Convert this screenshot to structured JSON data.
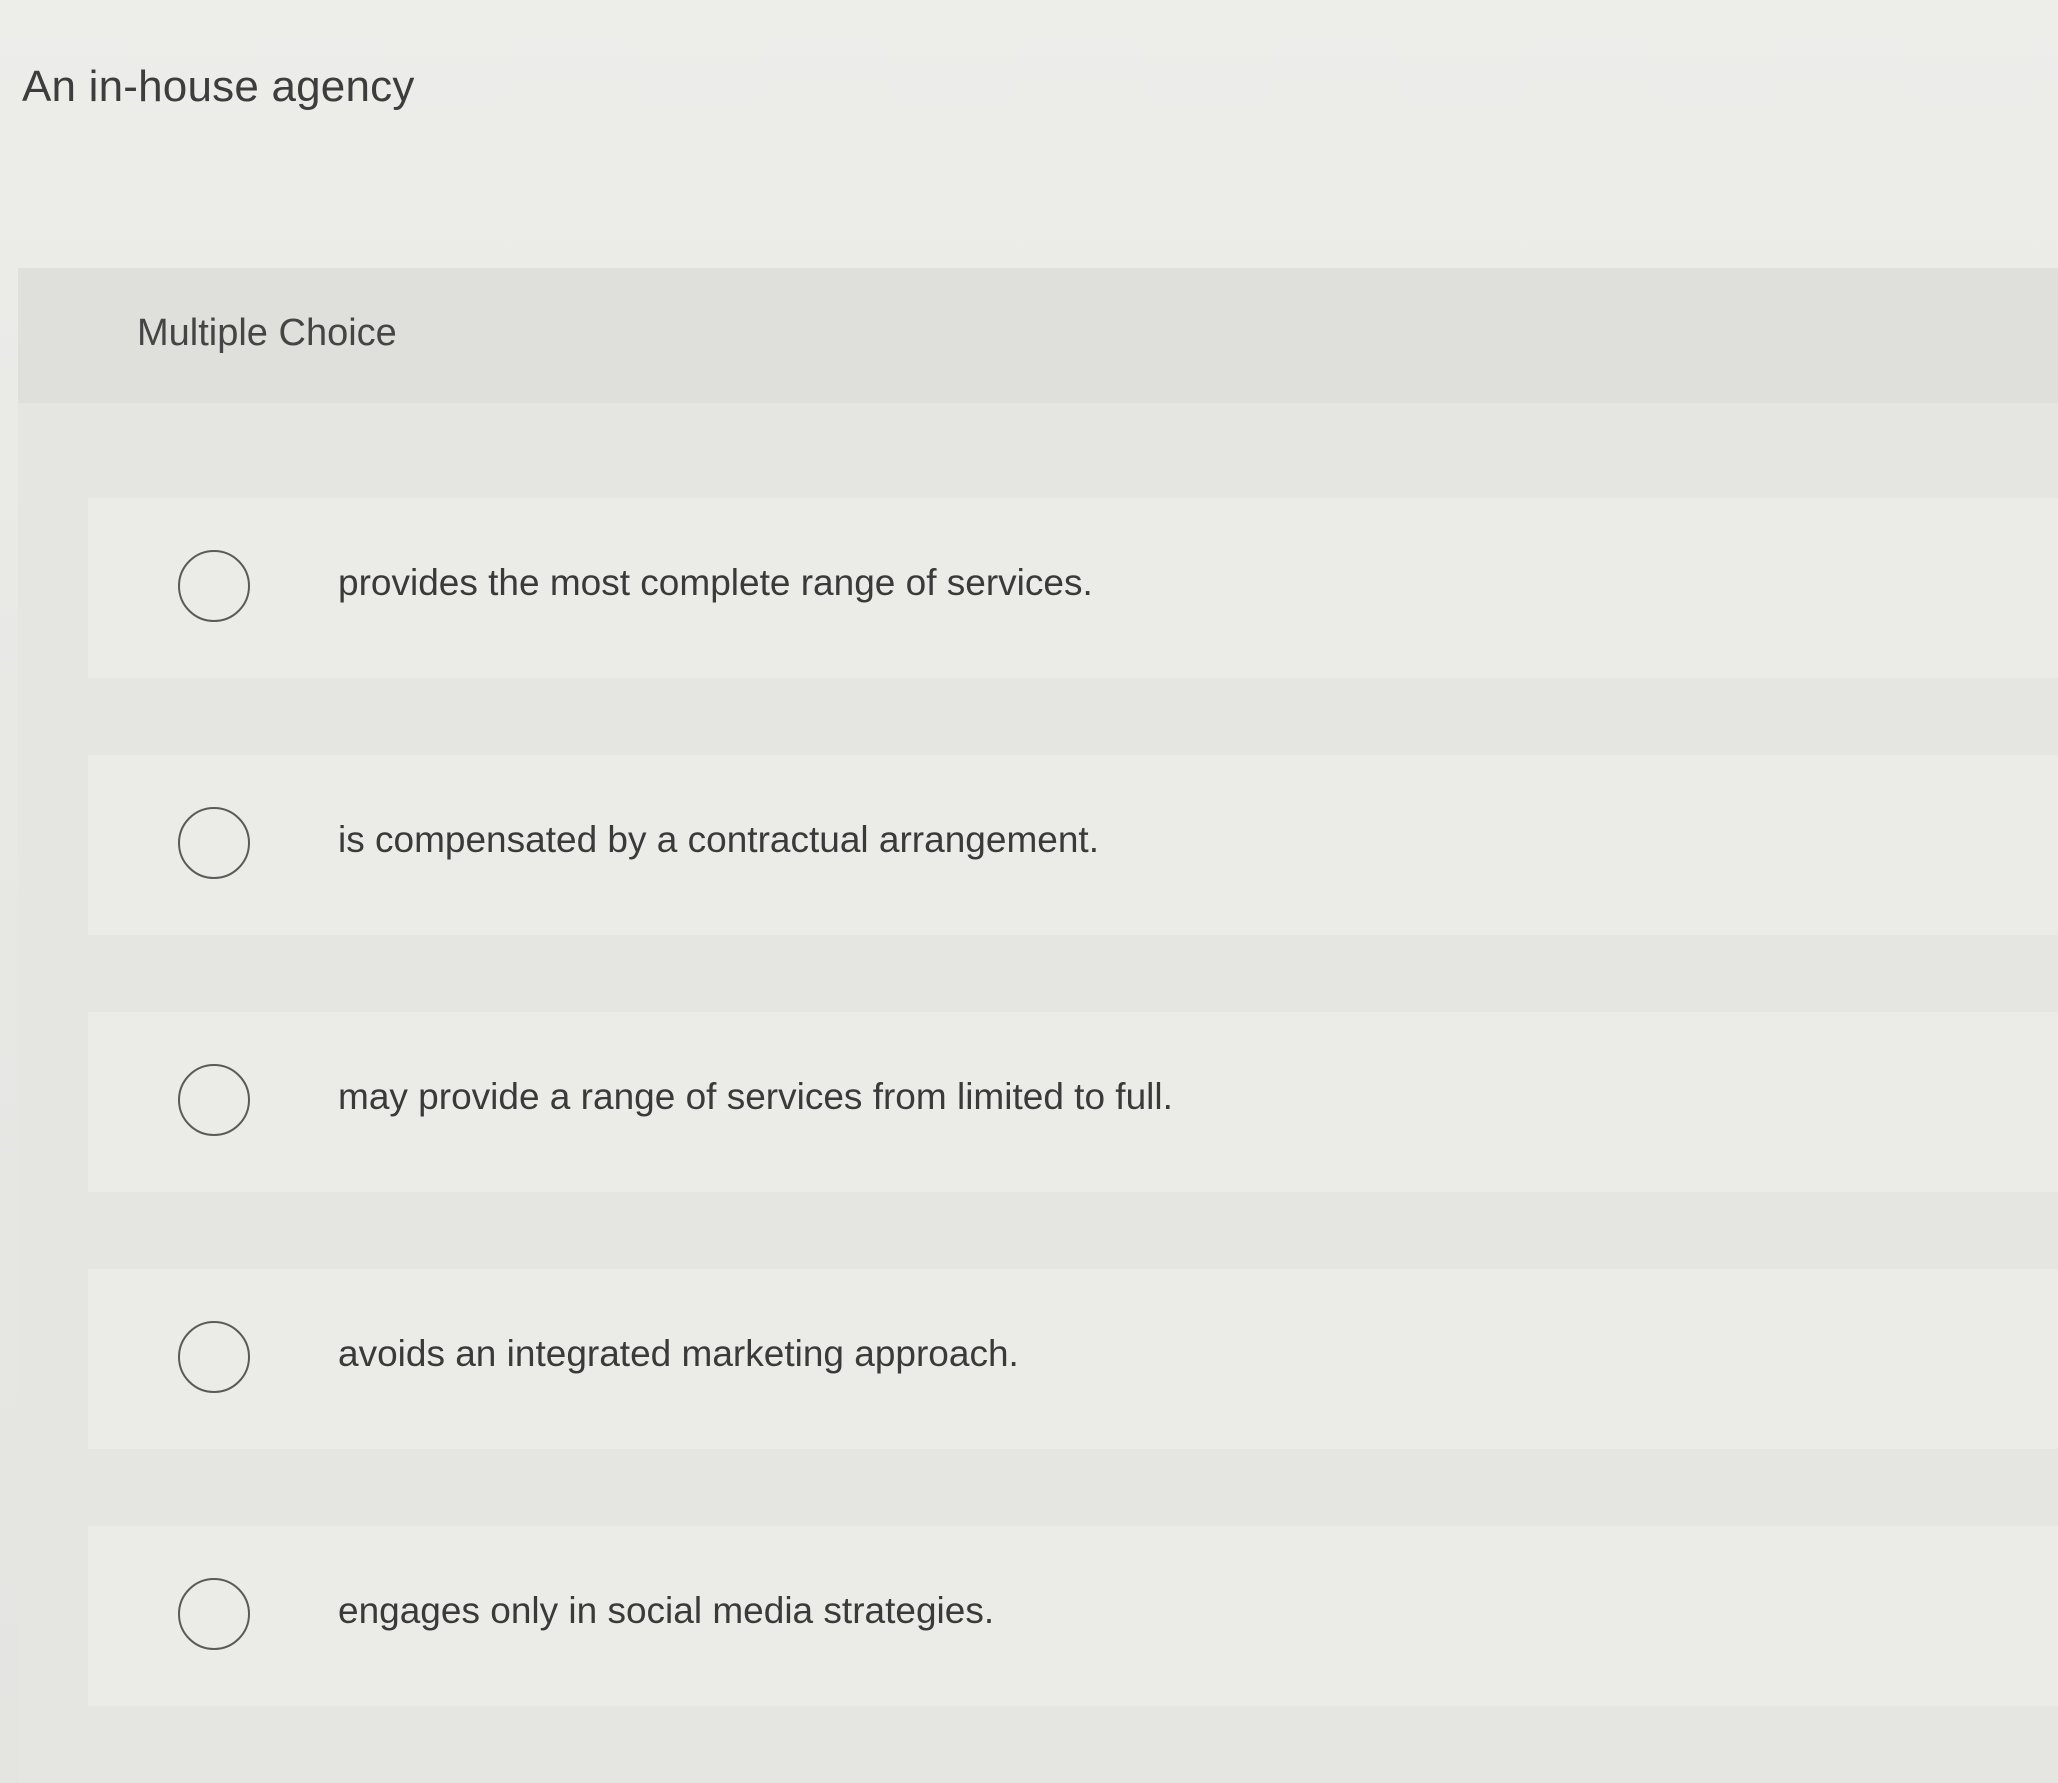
{
  "question": {
    "text": "An in-house agency"
  },
  "panel": {
    "title": "Multiple Choice"
  },
  "options": [
    {
      "label": "provides the most complete range of services."
    },
    {
      "label": "is compensated by a contractual arrangement."
    },
    {
      "label": "may provide a range of services from limited to full."
    },
    {
      "label": "avoids an integrated marketing approach."
    },
    {
      "label": "engages only in social media strategies."
    }
  ]
}
